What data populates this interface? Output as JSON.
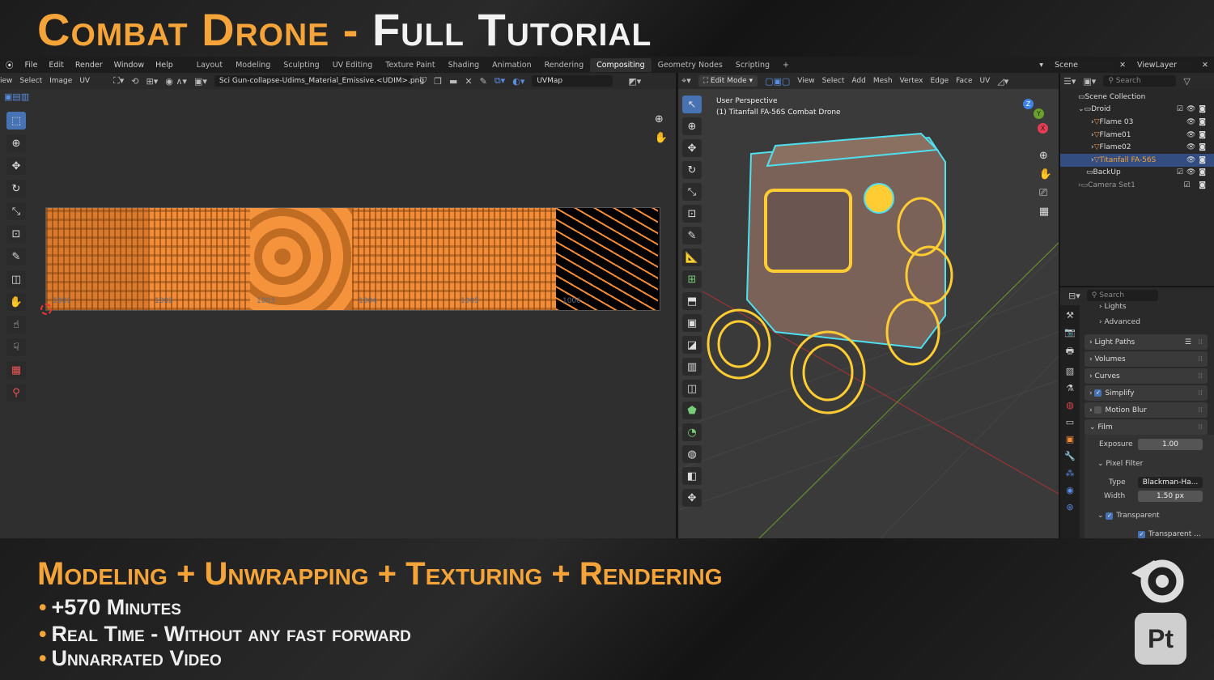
{
  "banner": {
    "title_orange": "Combat Drone -",
    "title_white": "Full Tutorial",
    "headline": "Modeling + Unwrapping + Texturing + Rendering",
    "bullets": [
      "+570 Minutes",
      "Real Time - Without any fast forward",
      "Unnarrated Video"
    ],
    "logo_pt": "Pt"
  },
  "topbar": {
    "menus": [
      "File",
      "Edit",
      "Render",
      "Window",
      "Help"
    ],
    "workspaces": [
      "Layout",
      "Modeling",
      "Sculpting",
      "UV Editing",
      "Texture Paint",
      "Shading",
      "Animation",
      "Rendering",
      "Compositing",
      "Geometry Nodes",
      "Scripting",
      "+"
    ],
    "active_workspace": "Compositing",
    "scene": "Scene",
    "view_layer": "ViewLayer"
  },
  "uv_editor": {
    "menus": [
      "View",
      "Select",
      "Image",
      "UV"
    ],
    "image_name": "Sci Gun-collapse-Udims_Material_Emissive.<UDIM>.png",
    "uv_map": "UVMap",
    "tiles": [
      "1001",
      "1002",
      "1003",
      "1004",
      "1005",
      "1006"
    ]
  },
  "viewport": {
    "mode": "Edit Mode",
    "menus": [
      "View",
      "Select",
      "Add",
      "Mesh",
      "Vertex",
      "Edge",
      "Face",
      "UV"
    ],
    "perspective": "User Perspective",
    "object_label": "(1) Titanfall FA-56S Combat Drone",
    "axes": [
      "X",
      "Y",
      "Z"
    ]
  },
  "outliner": {
    "search_placeholder": "Search",
    "scene_collection": "Scene Collection",
    "items": [
      {
        "name": "Droid"
      },
      {
        "name": "Flame 03"
      },
      {
        "name": "Flame01"
      },
      {
        "name": "Flame02"
      },
      {
        "name": "Titanfall FA-56S"
      },
      {
        "name": "BackUp"
      },
      {
        "name": "Camera Set1"
      }
    ]
  },
  "properties": {
    "search_placeholder": "Search",
    "sub": [
      "Lights",
      "Advanced"
    ],
    "panels": [
      "Light Paths",
      "Volumes",
      "Curves",
      "Simplify",
      "Motion Blur",
      "Film"
    ],
    "exposure_label": "Exposure",
    "exposure": "1.00",
    "pixel_filter": "Pixel Filter",
    "type_label": "Type",
    "type_value": "Blackman-Ha...",
    "width_label": "Width",
    "width_value": "1.50 px",
    "transparent": "Transparent",
    "transparent2": "Transparent ..."
  },
  "colors": {
    "accent": "#f5a43a",
    "selection": "#4772b3",
    "uv_orange": "#f28c38",
    "wire_yellow": "#ffcc33",
    "wire_cyan": "#4fe0f0"
  }
}
